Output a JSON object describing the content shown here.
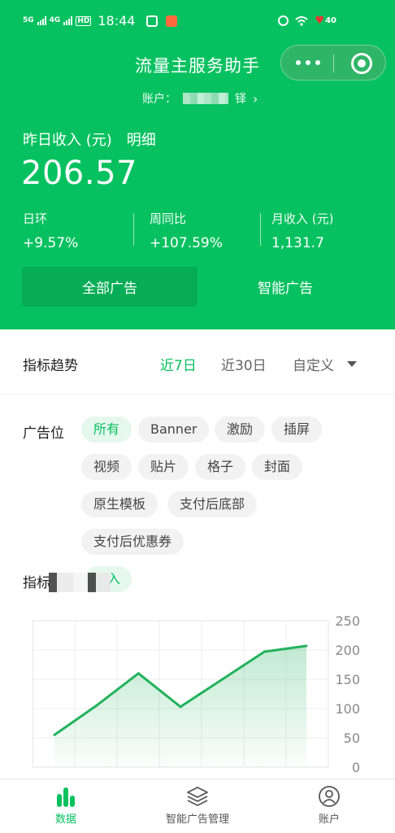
{
  "status_bar": {
    "network_1": "5G",
    "network_2": "4G",
    "hd": "HD",
    "time": "18:44",
    "battery": "40",
    "app_icon_colors": [
      "#ffffff",
      "#ff6a3d"
    ]
  },
  "header": {
    "title": "流量主服务助手",
    "account_label": "账户：",
    "account_suffix": "铎"
  },
  "yesterday": {
    "label": "昨日收入 (元)",
    "detail_link": "明细",
    "value": "206.57"
  },
  "stats": [
    {
      "label": "日环",
      "value": "+9.57%"
    },
    {
      "label": "周同比",
      "value": "+107.59%"
    },
    {
      "label": "月收入 (元)",
      "value": "1,131.7"
    }
  ],
  "segments": {
    "all_ads": "全部广告",
    "smart_ads": "智能广告",
    "active": "all_ads"
  },
  "trend": {
    "title": "指标趋势",
    "tabs": [
      "近7日",
      "近30日",
      "自定义"
    ],
    "active_tab": "近7日"
  },
  "ad_position": {
    "label": "广告位",
    "chips": [
      "所有",
      "Banner",
      "激励",
      "插屏",
      "视频",
      "贴片",
      "格子",
      "封面",
      "原生模板",
      "支付后底部",
      "支付后优惠券"
    ],
    "active": "所有"
  },
  "metric": {
    "label": "指标",
    "selected": "入"
  },
  "chart_data": {
    "type": "area",
    "x": [
      1,
      2,
      3,
      4,
      5,
      6,
      7
    ],
    "values": [
      55,
      105,
      160,
      103,
      150,
      197,
      207
    ],
    "yticks": [
      0,
      50,
      100,
      150,
      200,
      250
    ],
    "ylim": [
      0,
      250
    ],
    "grid": true,
    "color": "#22b25c"
  },
  "tabbar": {
    "items": [
      "数据",
      "智能广告管理",
      "账户"
    ],
    "active": "数据"
  },
  "colors": {
    "brand_green": "#07c160",
    "active_segment": "#06ad56",
    "chip_bg": "#f2f2f2",
    "chip_active_bg": "#e6f7ee"
  }
}
